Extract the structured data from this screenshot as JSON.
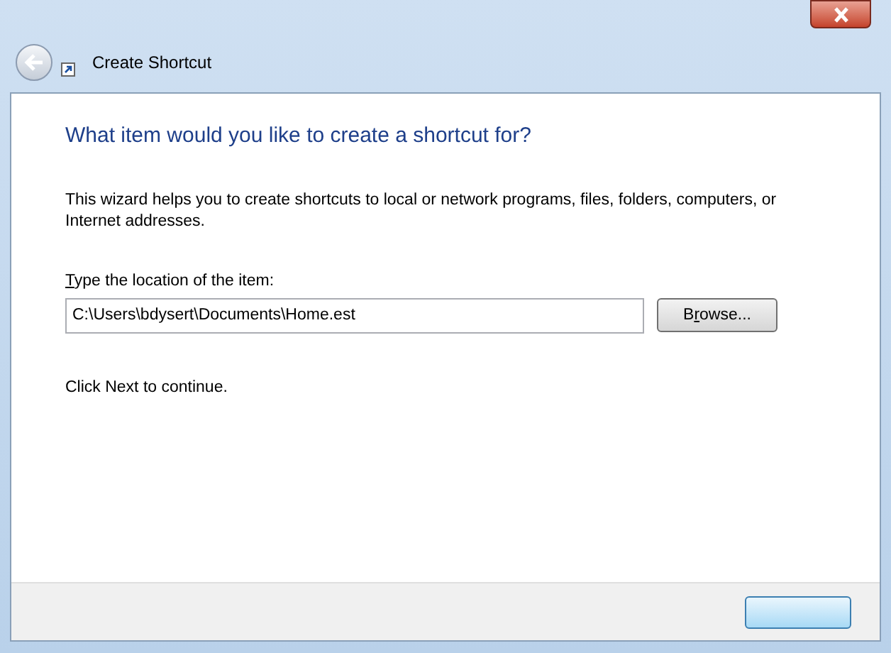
{
  "window": {
    "title": "Create Shortcut"
  },
  "heading": "What item would you like to create a shortcut for?",
  "description": "This wizard helps you to create shortcuts to local or network programs, files, folders, computers, or Internet addresses.",
  "location": {
    "label": {
      "key": "T",
      "rest": "ype the location of the item:"
    },
    "value": "C:\\Users\\bdysert\\Documents\\Home.est"
  },
  "browse_button": {
    "label": {
      "before": "B",
      "key": "r",
      "rest": "owse..."
    }
  },
  "hint": "Click Next to continue."
}
